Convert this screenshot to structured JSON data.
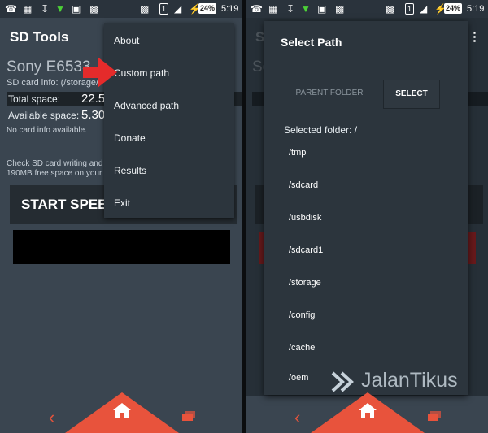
{
  "status_bar": {
    "sim_badge": "1",
    "battery": "24%",
    "time": "5:19"
  },
  "left": {
    "app_title": "SD Tools",
    "device_name": "Sony E6533",
    "card_info": "SD card info: (/storage/",
    "total_label": "Total space:",
    "total_value": "22.5",
    "available_label": "Available space:",
    "available_value": "5.30",
    "no_card": "No card info available.",
    "check_line1": "Check SD card writing and",
    "check_line2": "190MB free space on your",
    "start_button": "START SPEED",
    "menu": [
      {
        "label": "About"
      },
      {
        "label": "Custom path"
      },
      {
        "label": "Advanced path"
      },
      {
        "label": "Donate"
      },
      {
        "label": "Results"
      },
      {
        "label": "Exit"
      }
    ]
  },
  "right": {
    "bg_title": "Si",
    "bg_so": "So",
    "dialog_title": "Select Path",
    "parent_button": "PARENT FOLDER",
    "select_button": "SELECT",
    "selected_folder": "Selected folder: /",
    "folders": [
      {
        "path": "/tmp"
      },
      {
        "path": "/sdcard"
      },
      {
        "path": "/usbdisk"
      },
      {
        "path": "/sdcard1"
      },
      {
        "path": "/storage"
      },
      {
        "path": "/config"
      },
      {
        "path": "/cache"
      },
      {
        "path": "/oem"
      }
    ]
  },
  "watermark": "JalanTikus",
  "colors": {
    "accent": "#e8533c",
    "background": "#3a4550",
    "dialog": "#2c353d"
  }
}
